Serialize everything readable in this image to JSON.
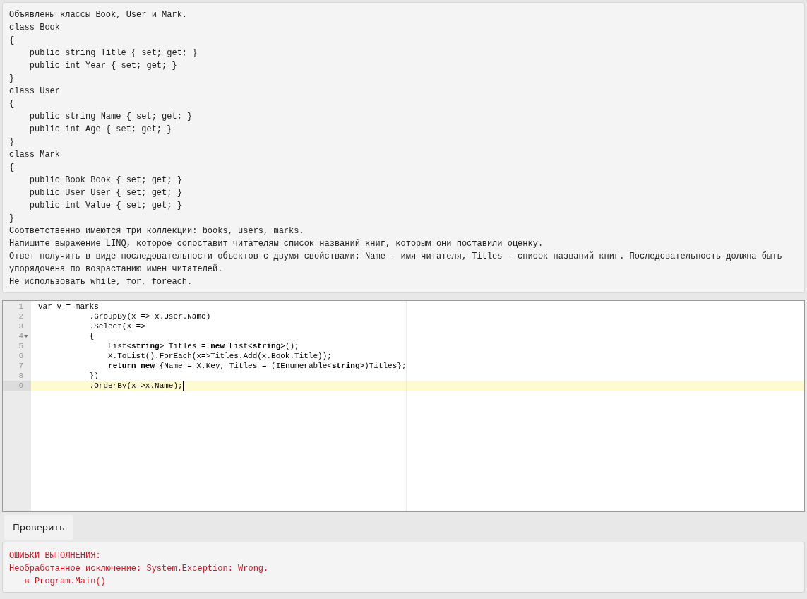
{
  "task": {
    "lines": [
      "Объявлены классы Book, User и Mark.",
      "class Book",
      "{",
      "    public string Title { set; get; }",
      "    public int Year { set; get; }",
      "}",
      "class User",
      "{",
      "    public string Name { set; get; }",
      "    public int Age { set; get; }",
      "}",
      "class Mark",
      "{",
      "    public Book Book { set; get; }",
      "    public User User { set; get; }",
      "    public int Value { set; get; }",
      "}",
      "Соответственно имеются три коллекции: books, users, marks.",
      "Напишите выражение LINQ, которое сопоставит читателям список названий книг, которым они поставили оценку.",
      "Ответ получить в виде последовательности объектов с двумя свойствами: Name - имя читателя, Titles - список названий книг. Последовательность должна быть упорядочена по возрастанию имен читателей.",
      "Не использовать while, for, foreach."
    ]
  },
  "editor": {
    "lines": [
      {
        "number": "1",
        "code": "var v = marks",
        "active": false,
        "foldable": false
      },
      {
        "number": "2",
        "code": "           .GroupBy(x => x.User.Name)",
        "active": false,
        "foldable": false
      },
      {
        "number": "3",
        "code": "           .Select(X =>",
        "active": false,
        "foldable": false
      },
      {
        "number": "4",
        "code": "           {",
        "active": false,
        "foldable": true
      },
      {
        "number": "5",
        "code": "               List<**string**> Titles = **new** List<**string**>();",
        "active": false,
        "foldable": false
      },
      {
        "number": "6",
        "code": "               X.ToList().ForEach(x=>Titles.Add(x.Book.Title));",
        "active": false,
        "foldable": false
      },
      {
        "number": "7",
        "code": "               **return** **new** {Name = X.Key, Titles = (IEnumerable<**string**>)Titles};",
        "active": false,
        "foldable": false
      },
      {
        "number": "8",
        "code": "           })",
        "active": false,
        "foldable": false
      },
      {
        "number": "9",
        "code": "           .OrderBy(x=>x.Name);",
        "active": true,
        "foldable": false
      }
    ]
  },
  "check_button": "Проверить",
  "output": {
    "lines": [
      "ОШИБКИ ВЫПОЛНЕНИЯ:",
      "Необработанное исключение: System.Exception: Wrong.",
      "   в Program.Main()"
    ]
  }
}
